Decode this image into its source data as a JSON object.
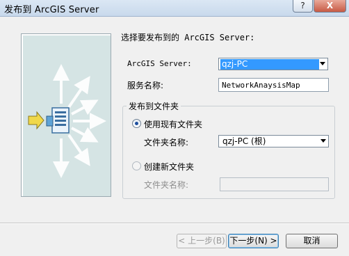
{
  "window": {
    "title": "发布到 ArcGIS Server",
    "help_glyph": "?",
    "close_glyph": "X"
  },
  "heading": "选择要发布到的 ArcGIS Server:",
  "server": {
    "label": "ArcGIS Server:",
    "value": "qzj-PC"
  },
  "service_name": {
    "label": "服务名称:",
    "value": "NetworkAnaysisMap"
  },
  "folder_group": {
    "title": "发布到文件夹",
    "use_existing": {
      "label": "使用现有文件夹",
      "checked": true,
      "folder_label": "文件夹名称:",
      "folder_value": "qzj-PC (根)"
    },
    "create_new": {
      "label": "创建新文件夹",
      "checked": false,
      "folder_label": "文件夹名称:",
      "folder_value": ""
    }
  },
  "buttons": {
    "back": "< 上一步(B)",
    "next": "下一步(N) >",
    "cancel": "取消"
  },
  "colors": {
    "selection": "#3399ff",
    "art_background": "#d5e4e4",
    "arrow_yellow": "#f0d84a"
  }
}
